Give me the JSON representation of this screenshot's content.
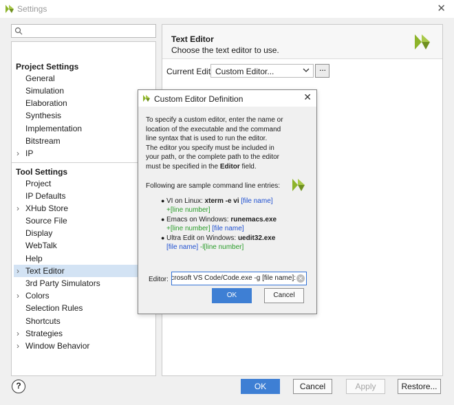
{
  "window": {
    "title": "Settings",
    "close_glyph": "✕"
  },
  "search": {
    "placeholder": ""
  },
  "tree": {
    "project_settings_header": "Project Settings",
    "project_items": [
      "General",
      "Simulation",
      "Elaboration",
      "Synthesis",
      "Implementation",
      "Bitstream",
      "IP"
    ],
    "tool_settings_header": "Tool Settings",
    "tool_items": [
      "Project",
      "IP Defaults",
      "XHub Store",
      "Source File",
      "Display",
      "WebTalk",
      "Help",
      "Text Editor",
      "3rd Party Simulators",
      "Colors",
      "Selection Rules",
      "Shortcuts",
      "Strategies",
      "Window Behavior"
    ],
    "selected": "Text Editor"
  },
  "right_panel": {
    "title": "Text Editor",
    "subtitle": "Choose the text editor to use.",
    "current_editor_label": "Current Editor:",
    "current_editor_value": "Custom Editor...",
    "browse_label": "···"
  },
  "dialog": {
    "title": "Custom Editor Definition",
    "close_glyph": "✕",
    "intro_line1": "To specify a custom editor, enter the name or location of the executable and the command line syntax that is used to run the editor.",
    "intro_line2_pre": "The editor you specify must be included in your path, or the complete path to the editor must be specified in the ",
    "intro_line2_bold": "Editor",
    "intro_line2_post": " field.",
    "samples_header": "Following are sample command line entries:",
    "samples": [
      {
        "os": "VI on Linux: ",
        "cmd": "xterm -e vi",
        "blue": " [file name]",
        "green": "+[line number]"
      },
      {
        "os": "Emacs on Windows: ",
        "cmd": "runemacs.exe",
        "green": "+[line number]",
        "blue": " [file name]"
      },
      {
        "os": "Ultra Edit on Windows: ",
        "cmd": "uedit32.exe",
        "blue": " [file name]",
        "green": " -l[line number]"
      }
    ],
    "editor_label": "Editor:",
    "editor_value": "'Microsoft VS Code/Code.exe -g [file name]:",
    "ok_label": "OK",
    "cancel_label": "Cancel"
  },
  "footer": {
    "help_label": "?",
    "ok_label": "OK",
    "cancel_label": "Cancel",
    "apply_label": "Apply",
    "restore_label": "Restore..."
  },
  "colors": {
    "primary_button": "#3e7fd4",
    "selection": "#d3e3f4",
    "link_blue": "#1e4fd0",
    "line_green": "#2a9c2a",
    "logo_green": "#8db42a"
  }
}
